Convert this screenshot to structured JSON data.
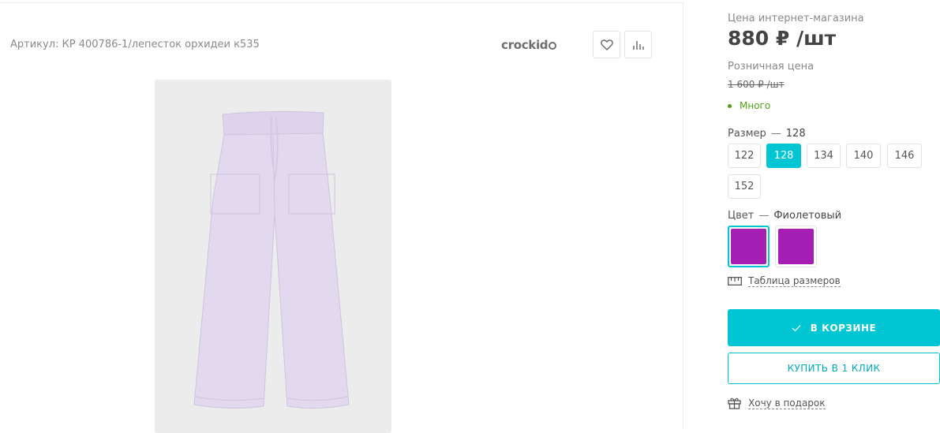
{
  "product": {
    "article": "Артикул: КР 400786-1/лепесток орхидеи к535",
    "brand": "crockid"
  },
  "actions": {
    "favorite_icon": "heart-icon",
    "compare_icon": "bar-chart-icon"
  },
  "pricing": {
    "online_label": "Цена интернет-магазина",
    "online_price": "880 ₽ /шт",
    "retail_label": "Розничная цена",
    "retail_price": "1 600 ₽ /шт",
    "stock": "Много",
    "stock_color": "#4fa018"
  },
  "size": {
    "label": "Размер",
    "separator": "—",
    "selected": "128",
    "options": [
      "122",
      "128",
      "134",
      "140",
      "146",
      "152"
    ]
  },
  "color": {
    "label": "Цвет",
    "separator": "—",
    "selected": "Фиолетовый",
    "swatches": [
      "#a51eb4",
      "#a51eb4"
    ],
    "accent": "#00c6d4"
  },
  "links": {
    "size_table": "Таблица размеров",
    "gift": "Хочу в подарок"
  },
  "buttons": {
    "in_cart": "В КОРЗИНЕ",
    "one_click": "КУПИТЬ В 1 КЛИК"
  }
}
